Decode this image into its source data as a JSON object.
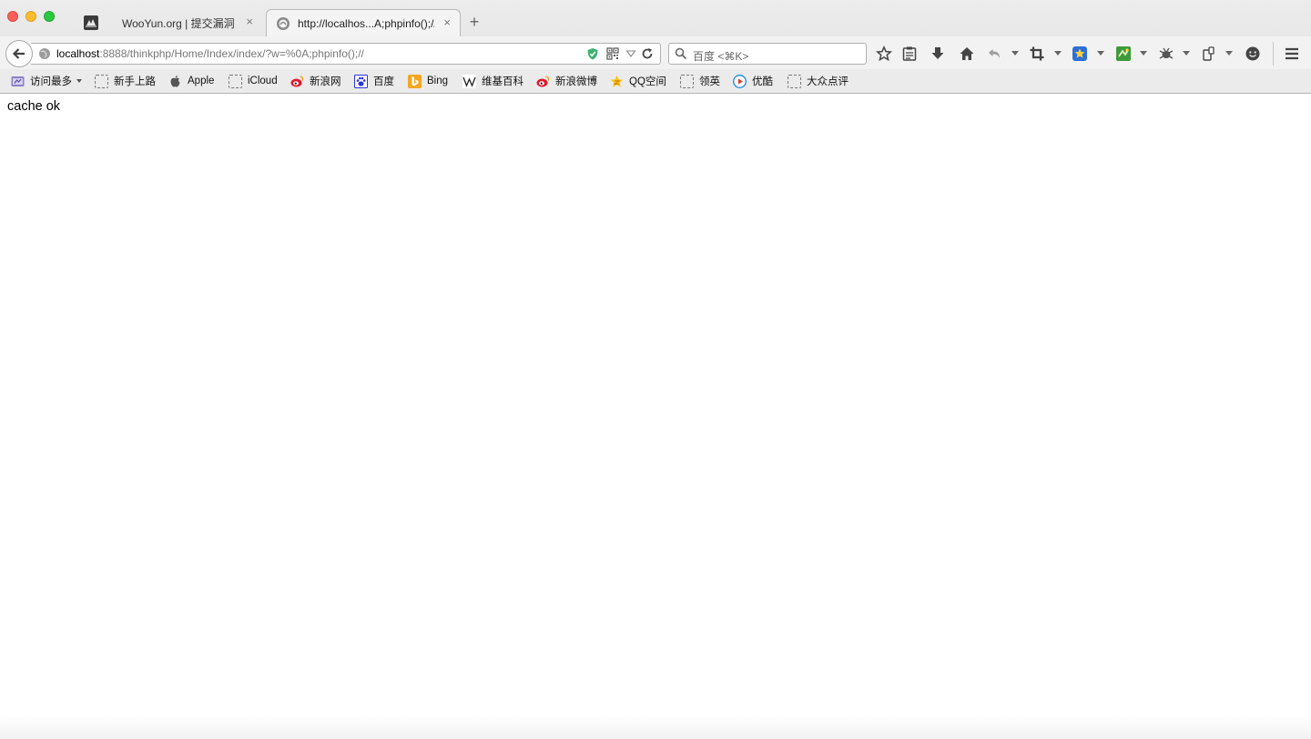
{
  "tabs": [
    {
      "label": "WooYun.org | 提交漏洞",
      "close": "×",
      "favicon": "wooyun-icon"
    },
    {
      "label": "http://localhos...A;phpinfo();//",
      "close": "×",
      "favicon": "page-icon"
    }
  ],
  "new_tab_label": "+",
  "url": {
    "host": "localhost",
    "rest": ":8888/thinkphp/Home/Index/index/?w=%0A;phpinfo();//"
  },
  "search": {
    "placeholder": "百度 <⌘K>"
  },
  "bookmarks": [
    {
      "label": "访问最多",
      "icon": "most-visited-icon"
    },
    {
      "label": "新手上路",
      "icon": "folder-icon"
    },
    {
      "label": "Apple",
      "icon": "apple-icon"
    },
    {
      "label": "iCloud",
      "icon": "folder-icon"
    },
    {
      "label": "新浪网",
      "icon": "weibo-icon"
    },
    {
      "label": "百度",
      "icon": "baidu-icon"
    },
    {
      "label": "Bing",
      "icon": "bing-icon"
    },
    {
      "label": "维基百科",
      "icon": "wikipedia-icon"
    },
    {
      "label": "新浪微博",
      "icon": "weibo-icon"
    },
    {
      "label": "QQ空间",
      "icon": "qzone-icon"
    },
    {
      "label": "领英",
      "icon": "folder-icon"
    },
    {
      "label": "优酷",
      "icon": "youku-icon"
    },
    {
      "label": "大众点评",
      "icon": "folder-icon"
    }
  ],
  "page": {
    "text": "cache ok"
  },
  "colors": {
    "close": "#fc5f57",
    "minimize": "#fdbc2e",
    "maximize": "#28c840",
    "shield": "#3cb371"
  }
}
